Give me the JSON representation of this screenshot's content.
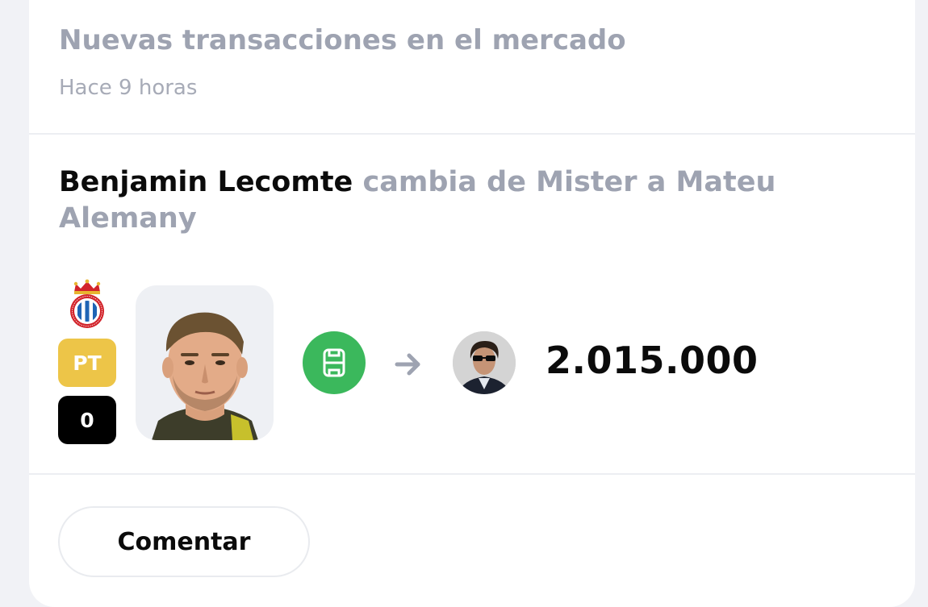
{
  "card": {
    "title": "Nuevas transacciones en el mercado",
    "time": "Hace 9 horas"
  },
  "transaction": {
    "player": "Benjamin Lecomte",
    "verb": "cambia de",
    "from_user": "Mister",
    "connector": "a",
    "to_user": "Mateu Alemany",
    "position": "PT",
    "points": "0",
    "price": "2.015.000",
    "team_crest_icon": "rcd-espanyol-crest-icon",
    "from_icon": "football-pitch-icon",
    "arrow_icon": "arrow-right-icon"
  },
  "actions": {
    "comment_label": "Comentar"
  },
  "colors": {
    "position_badge": "#edc548",
    "points_badge": "#000000",
    "market_icon_bg": "#3bb85c",
    "muted_text": "#9ea3b1"
  }
}
